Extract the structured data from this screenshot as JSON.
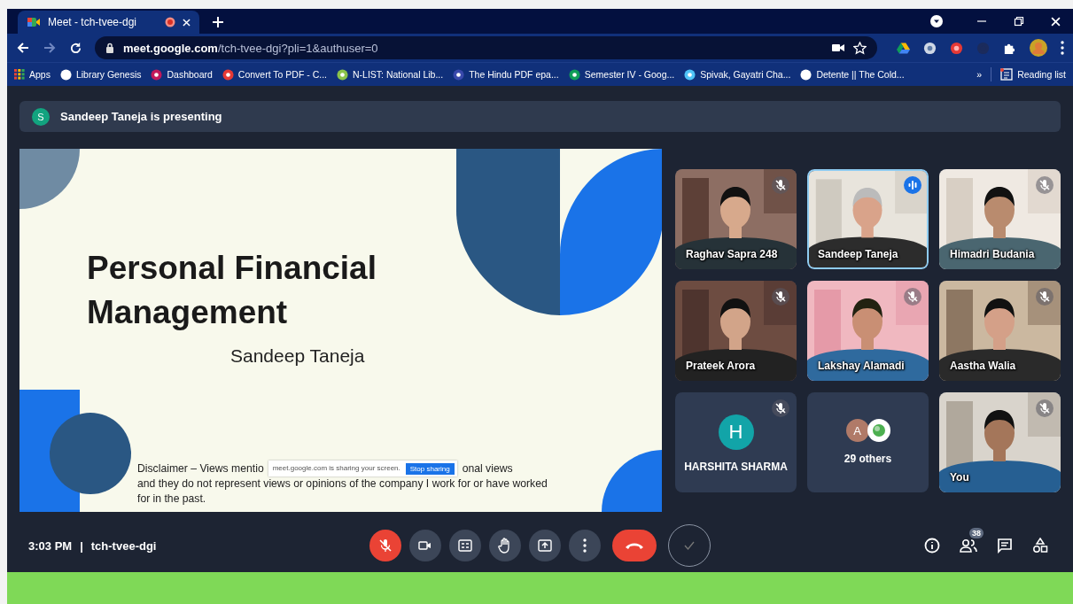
{
  "browser": {
    "tab": {
      "title": "Meet - tch-tvee-dgi"
    },
    "address": {
      "domain": "meet.google.com",
      "path": "/tch-tvee-dgi?pli=1&authuser=0"
    },
    "bookmarks": [
      {
        "label": "Apps",
        "kind": "apps"
      },
      {
        "label": "Library Genesis",
        "kind": "site"
      },
      {
        "label": "Dashboard",
        "kind": "site"
      },
      {
        "label": "Convert To PDF - C...",
        "kind": "site"
      },
      {
        "label": "N-LIST: National Lib...",
        "kind": "site"
      },
      {
        "label": "The Hindu PDF epa...",
        "kind": "site"
      },
      {
        "label": "Semester IV - Goog...",
        "kind": "site"
      },
      {
        "label": "Spivak, Gayatri Cha...",
        "kind": "site"
      },
      {
        "label": "Detente || The Cold...",
        "kind": "site"
      }
    ],
    "overflow": "»",
    "reading_list": "Reading list"
  },
  "meet": {
    "banner": {
      "initial": "S",
      "text": "Sandeep Taneja is presenting"
    },
    "slide": {
      "title": "Personal Financial Management",
      "presenter": "Sandeep Taneja",
      "disclaimer_start": "Disclaimer – Views mentio",
      "disclaimer_end": "onal views",
      "disclaimer_rest": "and they do not represent views or opinions of the company I work for or have worked for in the past.",
      "share_notice": {
        "text": "meet.google.com is sharing your screen.",
        "button": "Stop sharing"
      }
    },
    "tiles": [
      {
        "kind": "video",
        "name": "Raghav Sapra 248",
        "muted": true,
        "speaking": false
      },
      {
        "kind": "video",
        "name": "Sandeep Taneja",
        "muted": false,
        "speaking": true
      },
      {
        "kind": "video",
        "name": "Himadri Budania",
        "muted": true,
        "speaking": false
      },
      {
        "kind": "video",
        "name": "Prateek Arora",
        "muted": true,
        "speaking": false
      },
      {
        "kind": "video",
        "name": "Lakshay Alamadi",
        "muted": true,
        "speaking": false
      },
      {
        "kind": "video",
        "name": "Aastha Walia",
        "muted": true,
        "speaking": false
      },
      {
        "kind": "avatar",
        "name": "HARSHITA SHARMA",
        "initial": "H",
        "muted": true,
        "speaking": false
      },
      {
        "kind": "others",
        "name": "29 others",
        "initial": "A",
        "muted": false,
        "speaking": false
      },
      {
        "kind": "video",
        "name": "You",
        "muted": true,
        "speaking": false
      }
    ],
    "meeting": {
      "time": "3:03 PM",
      "separator": "|",
      "code": "tch-tvee-dgi",
      "people_count": "38",
      "controls": [
        {
          "kind": "mic",
          "on": false
        },
        {
          "kind": "camera",
          "on": true
        },
        {
          "kind": "captions",
          "on": false
        },
        {
          "kind": "hand",
          "on": false
        },
        {
          "kind": "present",
          "on": false
        },
        {
          "kind": "more"
        },
        {
          "kind": "leave"
        },
        {
          "kind": "extension"
        }
      ]
    }
  }
}
